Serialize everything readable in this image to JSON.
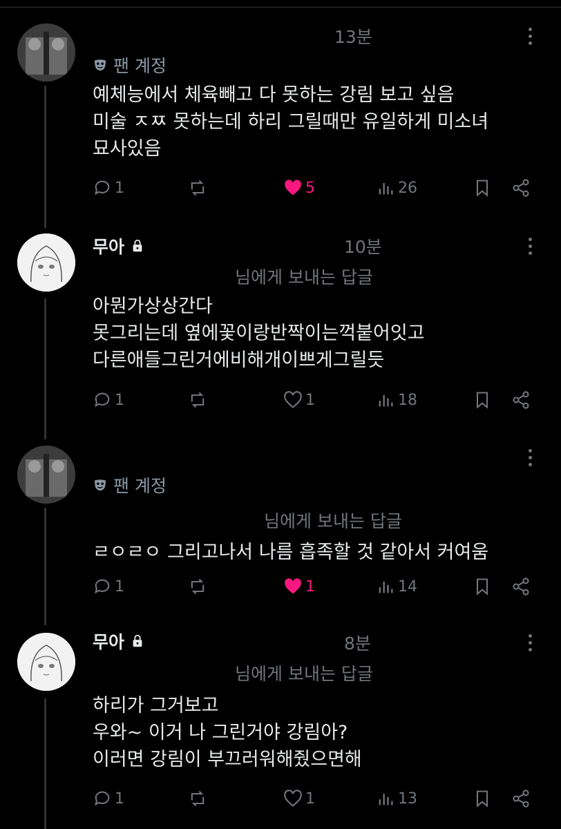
{
  "posts": [
    {
      "type": "fan",
      "fan_label": "팬 계정",
      "time": "13분",
      "lines": [
        "예체능에서 체육빼고 다 못하는 강림 보고 싶음",
        "미술 ㅈㅉ 못하는데 하리 그릴때만 유일하게 미소녀",
        "묘사있음"
      ],
      "replies": "1",
      "likes": "5",
      "liked": true,
      "views": "26"
    },
    {
      "type": "user",
      "name": "무아",
      "time": "10분",
      "reply_to": "님에게 보내는 답글",
      "lines": [
        "아뭔가상상간다",
        "못그리는데 옆에꽃이랑반짝이는꺽붙어잇고",
        "다른애들그린거에비해개이쁘게그릴듯"
      ],
      "replies": "1",
      "likes": "1",
      "liked": false,
      "views": "18"
    },
    {
      "type": "fan",
      "fan_label": "팬 계정",
      "reply_to": "님에게 보내는 답글",
      "lines": [
        "ㄹㅇㄹㅇ 그리고나서 나름 흡족할 것 같아서 커여움"
      ],
      "replies": "1",
      "likes": "1",
      "liked": true,
      "views": "14"
    },
    {
      "type": "user",
      "name": "무아",
      "time": "8분",
      "reply_to": "님에게 보내는 답글",
      "lines": [
        "하리가 그거보고",
        "우와~ 이거 나 그린거야 강림아?",
        "이러면 강림이 부끄러워해줬으면해"
      ],
      "replies": "1",
      "likes": "1",
      "liked": false,
      "views": "13"
    }
  ],
  "colors": {
    "background": "#000000",
    "text": "#e7e9ea",
    "muted": "#71767b",
    "like": "#f91880"
  }
}
